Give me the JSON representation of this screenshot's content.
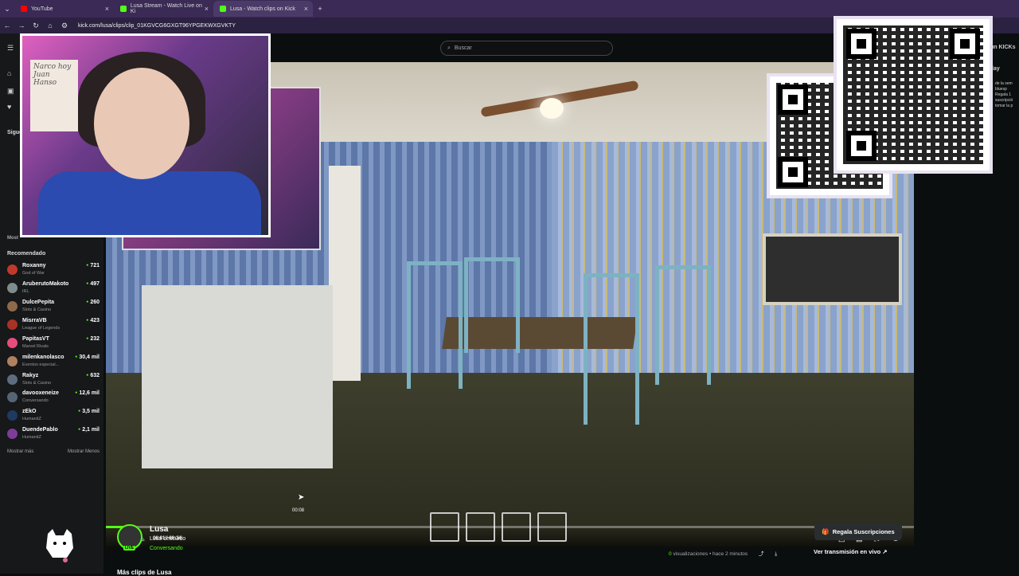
{
  "browser": {
    "tabs": [
      {
        "label": "YouTube",
        "color": "#ff0000"
      },
      {
        "label": "Lusa Stream - Watch Live on Ki",
        "color": "#53fc18"
      },
      {
        "label": "Lusa - Watch clips on Kick",
        "color": "#53fc18",
        "active": true
      }
    ],
    "url": "kick.com/lusa/clips/clip_01KGVCG6GXGT96YPGEKWXGVKTY"
  },
  "search": {
    "placeholder": "Buscar"
  },
  "sidebar": {
    "following_title": "Sigue",
    "more_label": "Most",
    "recommended_title": "Recomendado",
    "recommended": [
      {
        "name": "Roxanny",
        "category": "God of War",
        "viewers": "721",
        "color": "#c0392b"
      },
      {
        "name": "AruberutoMakoto",
        "category": "IRL",
        "viewers": "497",
        "color": "#7f8c8d"
      },
      {
        "name": "DulcePepita",
        "category": "Slots & Casino",
        "viewers": "260",
        "color": "#8e6a4a"
      },
      {
        "name": "MisrraVB",
        "category": "League of Legends",
        "viewers": "423",
        "color": "#a93226"
      },
      {
        "name": "PapitasVT",
        "category": "Marvel Rivals",
        "viewers": "232",
        "color": "#e74c7c"
      },
      {
        "name": "milenkanolasco",
        "category": "Eventos especial...",
        "viewers": "30,4 mil",
        "color": "#b08060"
      },
      {
        "name": "Rakyz",
        "category": "Slots & Casino",
        "viewers": "632",
        "color": "#5d6d7e"
      },
      {
        "name": "davooxeneize",
        "category": "Conversando",
        "viewers": "12,6 mil",
        "color": "#566573"
      },
      {
        "name": "zEkO",
        "category": "HumanitZ",
        "viewers": "3,5 mil",
        "color": "#1f3a60"
      },
      {
        "name": "DuendePablo",
        "category": "HumanitZ",
        "viewers": "2,1 mil",
        "color": "#7d3c98"
      }
    ],
    "show_more": "Mostrar más",
    "show_less": "Mostrar Menos"
  },
  "player": {
    "current_time": "00:01 / 00:34",
    "hover_time": "00:08",
    "progress": 0.03
  },
  "webcam_note": "Narco hoy Juan Hanso",
  "right_panel": {
    "kicks_label": "ún KICKs",
    "play_label": "lay",
    "promo_text": "de la sem bluesp Regala 1 suscripció tomar la p"
  },
  "channel": {
    "name": "Lusa",
    "live_badge": "LIVE",
    "title": "Lusa descuido",
    "category": "Conversando"
  },
  "actions": {
    "subscribe_gift": "Regala Suscripciones",
    "views_count": "0",
    "views_label": "visualizaciones",
    "ago": "• hace 2 minutos",
    "watch_live": "Ver transmisión en vivo"
  },
  "more_clips": "Más clips de Lusa"
}
